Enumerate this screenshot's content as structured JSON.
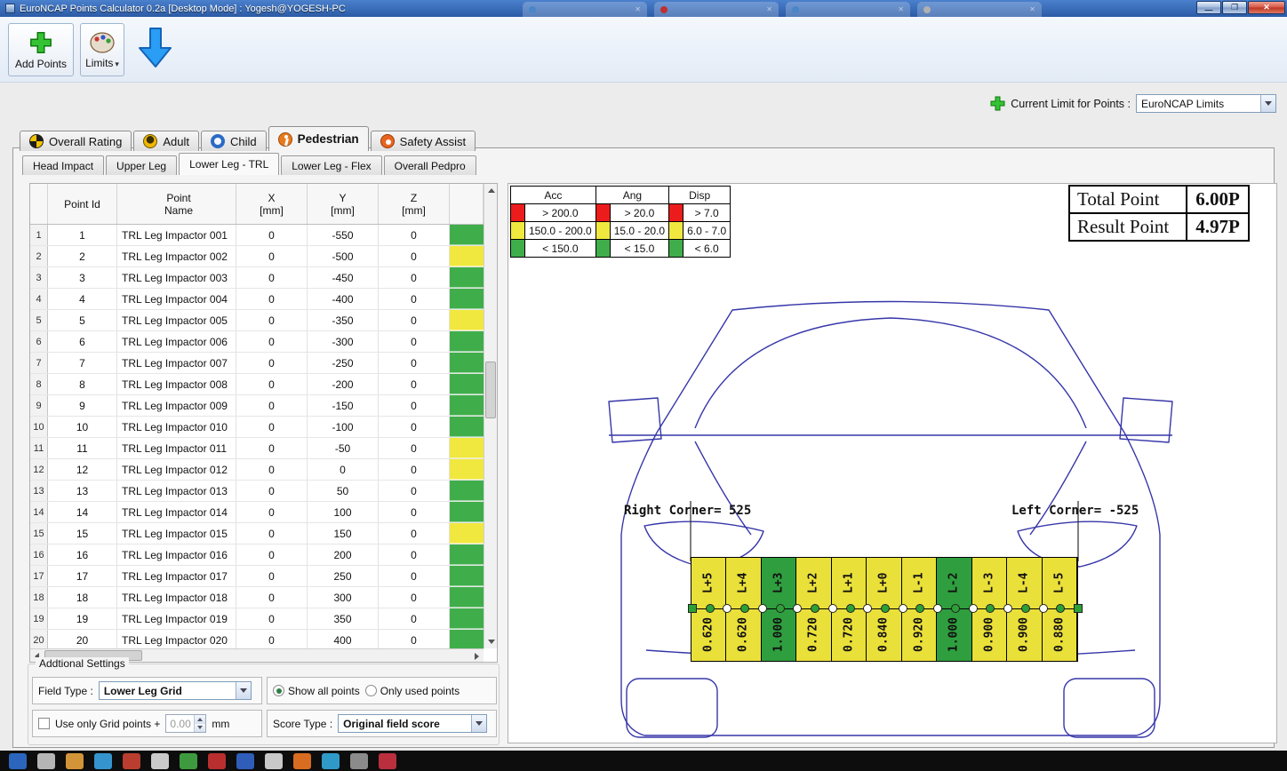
{
  "window": {
    "title": "EuroNCAP Points Calculator 0.2a [Desktop Mode] : Yogesh@YOGESH-PC",
    "background_tab_colors": [
      "#4a86c8",
      "#c03030",
      "#4a86c8",
      "#b0b0b0"
    ]
  },
  "toolbar": {
    "add_points": "Add Points",
    "limits": "Limits"
  },
  "limit_selector": {
    "label": "Current Limit for Points :",
    "value": "EuroNCAP Limits"
  },
  "main_tabs": [
    {
      "label": "Overall Rating",
      "icon": "icon-wheel",
      "active": false
    },
    {
      "label": "Adult",
      "icon": "icon-adult",
      "active": false
    },
    {
      "label": "Child",
      "icon": "icon-child",
      "active": false
    },
    {
      "label": "Pedestrian",
      "icon": "icon-ped",
      "active": true
    },
    {
      "label": "Safety Assist",
      "icon": "icon-assist",
      "active": false
    }
  ],
  "sub_tabs": [
    {
      "label": "Head Impact",
      "active": false
    },
    {
      "label": "Upper Leg",
      "active": false
    },
    {
      "label": "Lower Leg - TRL",
      "active": true
    },
    {
      "label": "Lower Leg - Flex",
      "active": false
    },
    {
      "label": "Overall Pedpro",
      "active": false
    }
  ],
  "points_table": {
    "headers": {
      "id": "Point Id",
      "name1": "Point",
      "name2": "Name",
      "x1": "X",
      "x2": "[mm]",
      "y1": "Y",
      "y2": "[mm]",
      "z1": "Z",
      "z2": "[mm]"
    },
    "rows": [
      {
        "n": "1",
        "id": "1",
        "name": "TRL Leg Impactor 001",
        "x": "0",
        "y": "-550",
        "z": "0",
        "status": "green"
      },
      {
        "n": "2",
        "id": "2",
        "name": "TRL Leg Impactor 002",
        "x": "0",
        "y": "-500",
        "z": "0",
        "status": "yellow"
      },
      {
        "n": "3",
        "id": "3",
        "name": "TRL Leg Impactor 003",
        "x": "0",
        "y": "-450",
        "z": "0",
        "status": "green"
      },
      {
        "n": "4",
        "id": "4",
        "name": "TRL Leg Impactor 004",
        "x": "0",
        "y": "-400",
        "z": "0",
        "status": "green"
      },
      {
        "n": "5",
        "id": "5",
        "name": "TRL Leg Impactor 005",
        "x": "0",
        "y": "-350",
        "z": "0",
        "status": "yellow"
      },
      {
        "n": "6",
        "id": "6",
        "name": "TRL Leg Impactor 006",
        "x": "0",
        "y": "-300",
        "z": "0",
        "status": "green"
      },
      {
        "n": "7",
        "id": "7",
        "name": "TRL Leg Impactor 007",
        "x": "0",
        "y": "-250",
        "z": "0",
        "status": "green"
      },
      {
        "n": "8",
        "id": "8",
        "name": "TRL Leg Impactor 008",
        "x": "0",
        "y": "-200",
        "z": "0",
        "status": "green"
      },
      {
        "n": "9",
        "id": "9",
        "name": "TRL Leg Impactor 009",
        "x": "0",
        "y": "-150",
        "z": "0",
        "status": "green"
      },
      {
        "n": "10",
        "id": "10",
        "name": "TRL Leg Impactor 010",
        "x": "0",
        "y": "-100",
        "z": "0",
        "status": "green"
      },
      {
        "n": "11",
        "id": "11",
        "name": "TRL Leg Impactor 011",
        "x": "0",
        "y": "-50",
        "z": "0",
        "status": "yellow"
      },
      {
        "n": "12",
        "id": "12",
        "name": "TRL Leg Impactor 012",
        "x": "0",
        "y": "0",
        "z": "0",
        "status": "yellow"
      },
      {
        "n": "13",
        "id": "13",
        "name": "TRL Leg Impactor 013",
        "x": "0",
        "y": "50",
        "z": "0",
        "status": "green"
      },
      {
        "n": "14",
        "id": "14",
        "name": "TRL Leg Impactor 014",
        "x": "0",
        "y": "100",
        "z": "0",
        "status": "green"
      },
      {
        "n": "15",
        "id": "15",
        "name": "TRL Leg Impactor 015",
        "x": "0",
        "y": "150",
        "z": "0",
        "status": "yellow"
      },
      {
        "n": "16",
        "id": "16",
        "name": "TRL Leg Impactor 016",
        "x": "0",
        "y": "200",
        "z": "0",
        "status": "green"
      },
      {
        "n": "17",
        "id": "17",
        "name": "TRL Leg Impactor 017",
        "x": "0",
        "y": "250",
        "z": "0",
        "status": "green"
      },
      {
        "n": "18",
        "id": "18",
        "name": "TRL Leg Impactor 018",
        "x": "0",
        "y": "300",
        "z": "0",
        "status": "green"
      },
      {
        "n": "19",
        "id": "19",
        "name": "TRL Leg Impactor 019",
        "x": "0",
        "y": "350",
        "z": "0",
        "status": "green"
      },
      {
        "n": "20",
        "id": "20",
        "name": "TRL Leg Impactor 020",
        "x": "0",
        "y": "400",
        "z": "0",
        "status": "green"
      }
    ]
  },
  "settings": {
    "group_title": "Addtional Settings",
    "field_type_label": "Field Type :",
    "field_type_value": "Lower Leg Grid",
    "radio_all": "Show all points",
    "radio_used": "Only used points",
    "grid_points_label": "Use only Grid points +",
    "grid_points_value": "0.00",
    "grid_points_unit": "mm",
    "score_type_label": "Score Type :",
    "score_type_value": "Original field score"
  },
  "limits_legend": {
    "columns": [
      {
        "name": "Acc",
        "rows": [
          {
            "color": "red",
            "text": "> 200.0"
          },
          {
            "color": "yellow",
            "text": "150.0 - 200.0"
          },
          {
            "color": "green",
            "text": "< 150.0"
          }
        ]
      },
      {
        "name": "Ang",
        "rows": [
          {
            "color": "red",
            "text": "> 20.0"
          },
          {
            "color": "yellow",
            "text": "15.0 - 20.0"
          },
          {
            "color": "green",
            "text": "< 15.0"
          }
        ]
      },
      {
        "name": "Disp",
        "rows": [
          {
            "color": "red",
            "text": "> 7.0"
          },
          {
            "color": "yellow",
            "text": "6.0 - 7.0"
          },
          {
            "color": "green",
            "text": "< 6.0"
          }
        ]
      }
    ]
  },
  "score_summary": {
    "total_label": "Total Point",
    "total_value": "6.00P",
    "result_label": "Result Point",
    "result_value": "4.97P"
  },
  "car_view": {
    "right_corner_label": "Right Corner= 525",
    "left_corner_label": "Left Corner= -525",
    "grid_cells": [
      {
        "label": "L+5",
        "value": "0.620",
        "color": "yellow"
      },
      {
        "label": "L+4",
        "value": "0.620",
        "color": "yellow"
      },
      {
        "label": "L+3",
        "value": "1.000",
        "color": "green"
      },
      {
        "label": "L+2",
        "value": "0.720",
        "color": "yellow"
      },
      {
        "label": "L+1",
        "value": "0.720",
        "color": "yellow"
      },
      {
        "label": "L+0",
        "value": "0.840",
        "color": "yellow"
      },
      {
        "label": "L-1",
        "value": "0.920",
        "color": "yellow"
      },
      {
        "label": "L-2",
        "value": "1.000",
        "color": "green"
      },
      {
        "label": "L-3",
        "value": "0.900",
        "color": "yellow"
      },
      {
        "label": "L-4",
        "value": "0.900",
        "color": "yellow"
      },
      {
        "label": "L-5",
        "value": "0.880",
        "color": "yellow"
      }
    ]
  },
  "colors": {
    "green": "#3fae4a",
    "yellow": "#f0e83e",
    "red": "#ed1c1c",
    "grid_green": "#2f9e3f",
    "grid_yellow": "#eae03a"
  },
  "taskbar": {
    "icon_colors": [
      "#2f6fd0",
      "#c8c8c8",
      "#e8a33d",
      "#3aa3e3",
      "#cc4433",
      "#e0e0e0",
      "#44aa44",
      "#cc3333",
      "#3366cc",
      "#dddddd",
      "#ee7722",
      "#33aadd",
      "#999999",
      "#cc3344"
    ]
  }
}
